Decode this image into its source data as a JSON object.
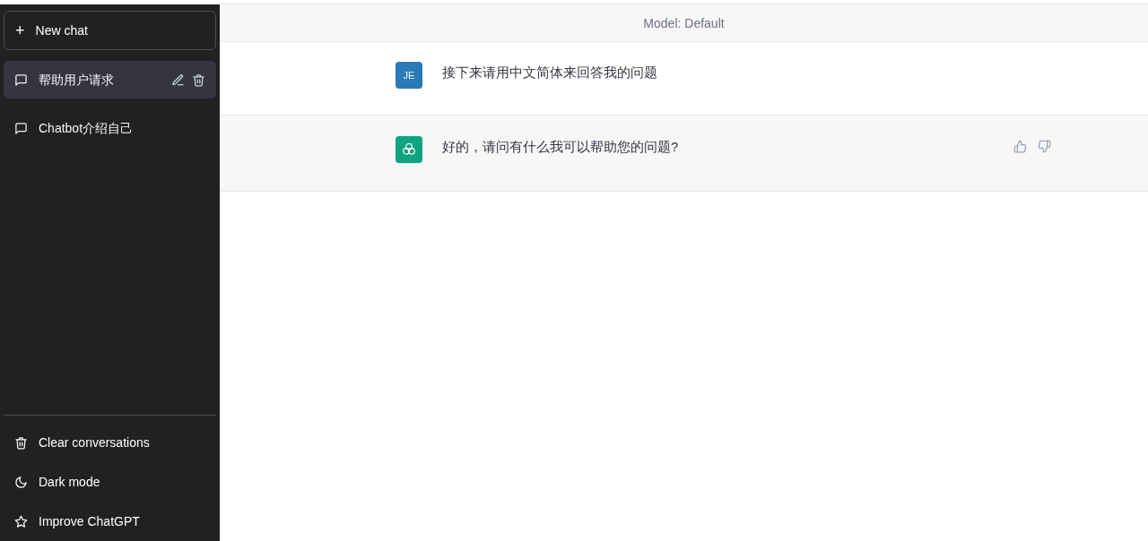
{
  "sidebar": {
    "new_chat": {
      "icon": "+",
      "label": "New chat"
    },
    "conversations": [
      {
        "title": "帮助用户请求",
        "selected": true
      },
      {
        "title": "Chatbot介绍自己",
        "selected": false
      }
    ],
    "menu": [
      {
        "kind": "trash",
        "label": "Clear conversations"
      },
      {
        "kind": "moon",
        "label": "Dark mode"
      },
      {
        "kind": "star",
        "label": "Improve ChatGPT"
      }
    ]
  },
  "header": {
    "model": "Model: Default"
  },
  "messages": [
    {
      "kind": "user",
      "avatar": "JE",
      "text": "接下来请用中文简体来回答我的问题"
    },
    {
      "kind": "assistant",
      "text": "好的，请问有什么我可以帮助您的问题?"
    }
  ]
}
